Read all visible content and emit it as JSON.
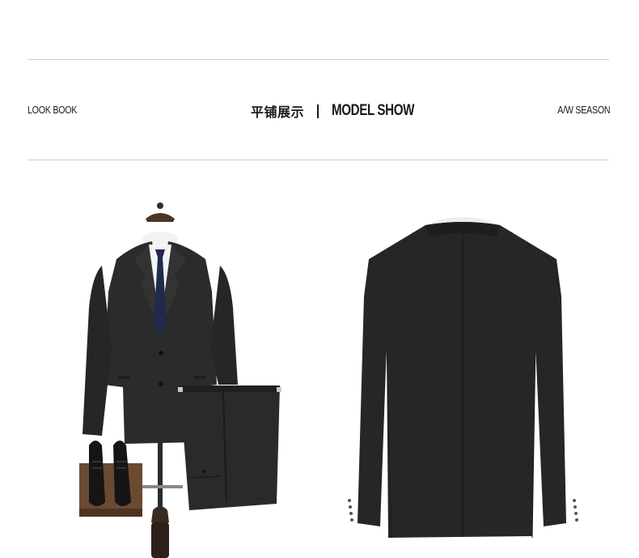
{
  "header": {
    "left_label": "LOOK BOOK",
    "center_cn": "平铺展示",
    "center_en": "MODEL SHOW",
    "right_label": "A/W SEASON"
  },
  "images": {
    "front": "suit-front-on-mannequin-with-trousers-and-shoes",
    "back": "suit-jacket-back-view"
  },
  "colors": {
    "suit": "#2b2b2b",
    "tie": "#1f2a4d",
    "rule": "#cfcfcf",
    "text": "#1a1a1a"
  }
}
